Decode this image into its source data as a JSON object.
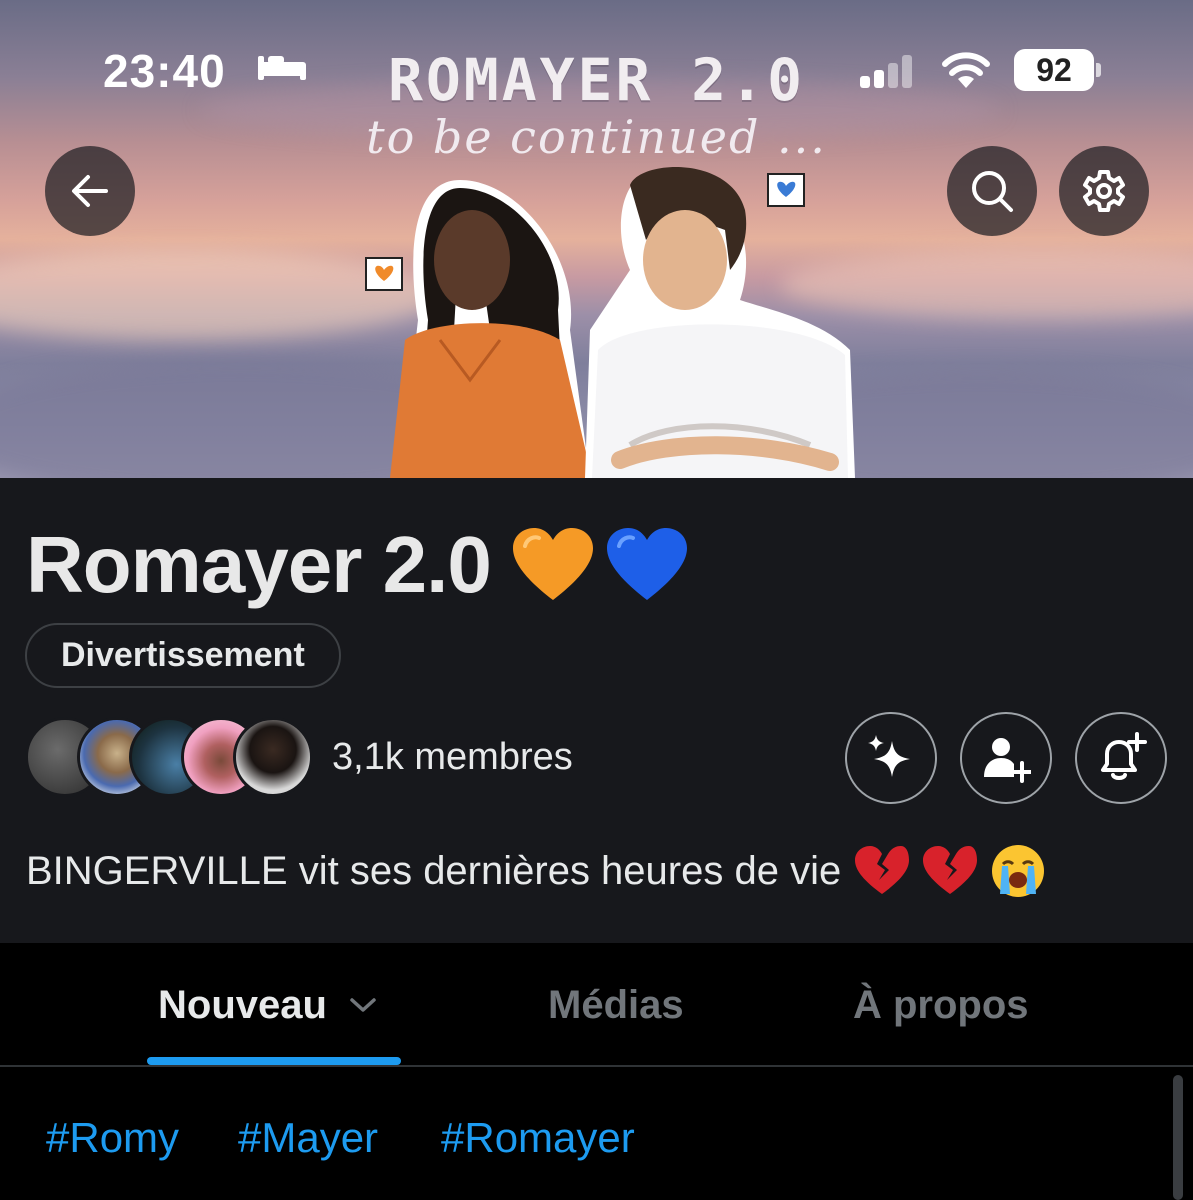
{
  "status_bar": {
    "time": "23:40",
    "battery": "92"
  },
  "banner": {
    "title": "ROMAYER 2.0",
    "subtitle": "to be continued ..."
  },
  "community": {
    "name": "Romayer 2.0",
    "name_emojis": [
      "orange-heart",
      "blue-heart"
    ],
    "category": "Divertissement",
    "members_label": "3,1k membres",
    "description": "BINGERVILLE vit ses dernières heures de vie",
    "description_emojis": [
      "broken-heart",
      "broken-heart",
      "loudly-crying-face"
    ]
  },
  "tabs": [
    {
      "label": "Nouveau",
      "active": true,
      "has_dropdown": true
    },
    {
      "label": "Médias",
      "active": false
    },
    {
      "label": "À propos",
      "active": false
    }
  ],
  "hashtags": [
    "#Romy",
    "#Mayer",
    "#Romayer"
  ],
  "colors": {
    "accent": "#1d9bf0",
    "panel": "#17181c",
    "background": "#000000",
    "muted": "#71767b"
  }
}
